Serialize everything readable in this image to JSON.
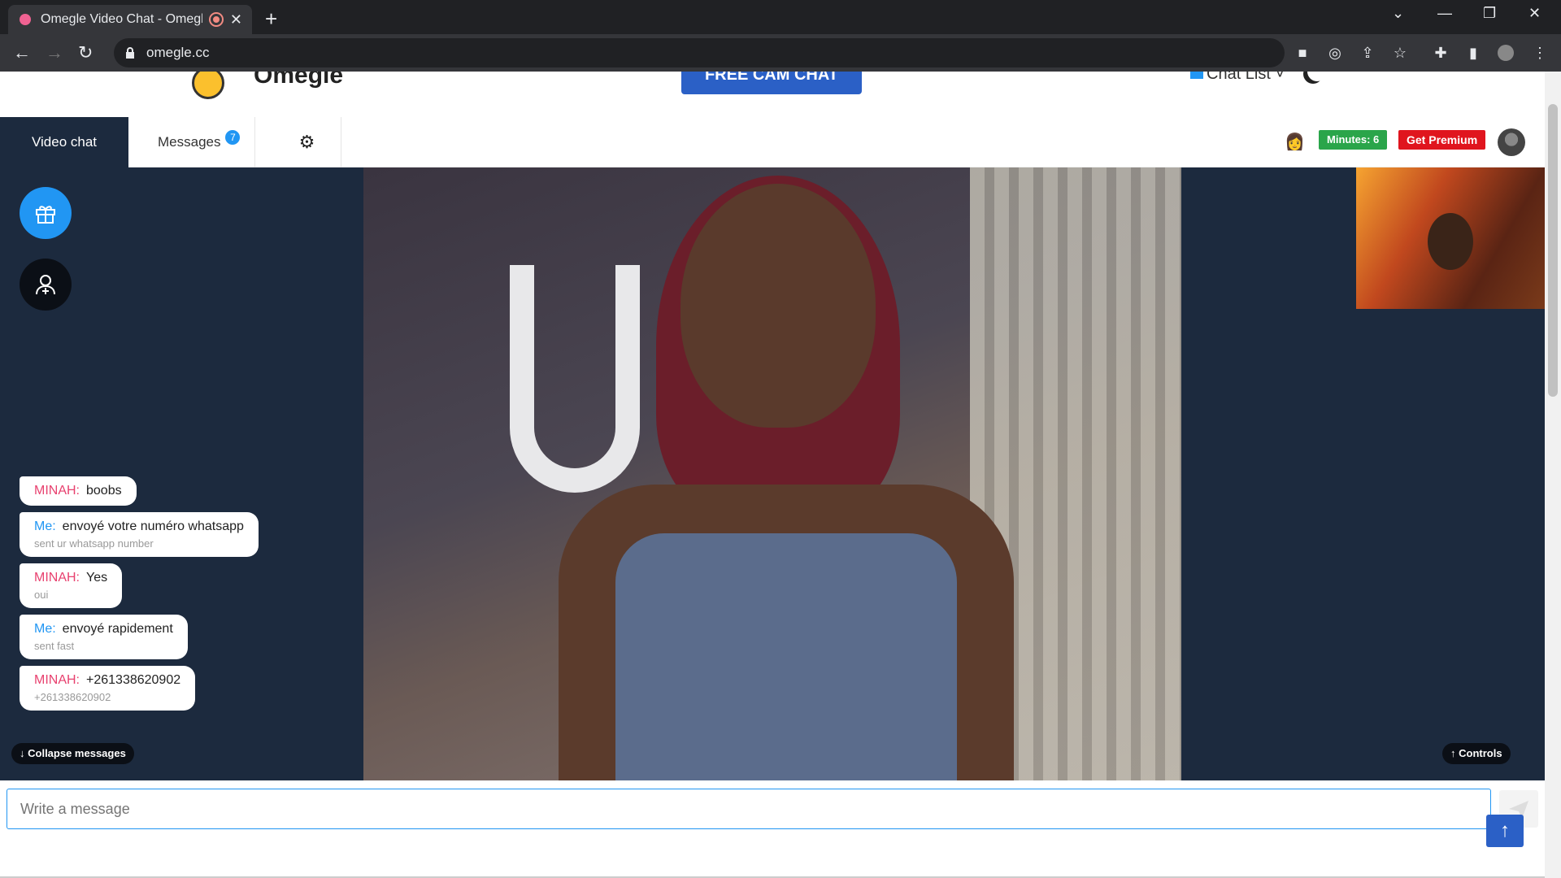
{
  "browser": {
    "tab_title": "Omegle Video Chat - Omegl",
    "new_tab": "+",
    "url": "omegle.cc"
  },
  "site": {
    "logo_text": "Omegle",
    "free_cam_label": "FREE CAM CHAT",
    "chat_list_label": "Chat List"
  },
  "tabs": {
    "video_chat": "Video chat",
    "messages": "Messages",
    "messages_badge": "7"
  },
  "status": {
    "minutes": "Minutes: 6",
    "premium": "Get Premium"
  },
  "messages": [
    {
      "sender": "MINAH:",
      "text": "boobs",
      "translation": ""
    },
    {
      "sender": "Me:",
      "text": "envoyé votre numéro whatsapp",
      "translation": "sent ur whatsapp number"
    },
    {
      "sender": "MINAH:",
      "text": "Yes",
      "translation": "oui"
    },
    {
      "sender": "Me:",
      "text": "envoyé rapidement",
      "translation": "sent fast"
    },
    {
      "sender": "MINAH:",
      "text": "+261338620902",
      "translation": "+261338620902"
    }
  ],
  "buttons": {
    "collapse": "Collapse messages",
    "controls": "Controls"
  },
  "composer": {
    "placeholder": "Write a message"
  },
  "colors": {
    "stage_bg": "#1c2a3e",
    "accent": "#2196f3",
    "minutes_bg": "#2aa54a",
    "premium_bg": "#e0151e"
  }
}
